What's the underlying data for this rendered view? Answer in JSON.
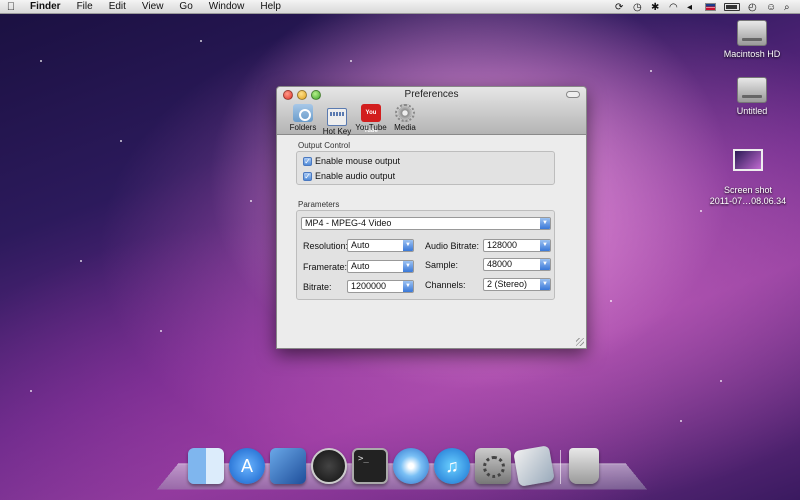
{
  "menubar": {
    "items": [
      "Finder",
      "File",
      "Edit",
      "View",
      "Go",
      "Window",
      "Help"
    ]
  },
  "desktop": {
    "icons": [
      {
        "label": "Macintosh HD"
      },
      {
        "label": "Untitled"
      },
      {
        "label": "Screen shot\n2011-07…08.06.34"
      }
    ]
  },
  "window": {
    "title": "Preferences",
    "toolbar": [
      {
        "label": "Folders",
        "icon": "folder-icon"
      },
      {
        "label": "Hot Key",
        "icon": "keyboard-icon"
      },
      {
        "label": "YouTube",
        "icon": "youtube-icon"
      },
      {
        "label": "Media",
        "icon": "gear-icon"
      }
    ],
    "youtube_icon_text": "You Tube",
    "output_control": {
      "label": "Output Control",
      "mouse_output": {
        "label": "Enable mouse output",
        "checked": true
      },
      "audio_output": {
        "label": "Enable audio output",
        "checked": true
      }
    },
    "parameters": {
      "label": "Parameters",
      "format": "MP4 - MPEG-4 Video",
      "resolution": {
        "label": "Resolution:",
        "value": "Auto"
      },
      "framerate": {
        "label": "Framerate:",
        "value": "Auto"
      },
      "bitrate": {
        "label": "Bitrate:",
        "value": "1200000"
      },
      "audio_bitrate": {
        "label": "Audio Bitrate:",
        "value": "128000"
      },
      "sample": {
        "label": "Sample:",
        "value": "48000"
      },
      "channels": {
        "label": "Channels:",
        "value": "2 (Stereo)"
      }
    }
  },
  "dock": {
    "icons": [
      "finder-icon",
      "app-store-icon",
      "xcode-icon",
      "dashboard-icon",
      "terminal-icon",
      "safari-icon",
      "itunes-icon",
      "system-preferences-icon",
      "preview-icon",
      "trash-icon"
    ]
  },
  "colors": {
    "accent": "#3a78d8",
    "close": "#e0342a",
    "minimize": "#e0a320",
    "zoom": "#3ea52a"
  }
}
